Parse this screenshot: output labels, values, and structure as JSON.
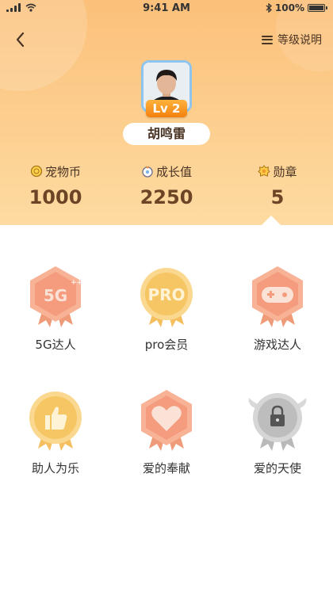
{
  "status_bar": {
    "time": "9:41 AM",
    "battery": "100%"
  },
  "header": {
    "level_desc_label": "等级说明"
  },
  "profile": {
    "level": "Lv 2",
    "name": "胡鸣雷"
  },
  "stats": [
    {
      "label": "宠物币",
      "value": "1000",
      "icon": "coin-icon"
    },
    {
      "label": "成长值",
      "value": "2250",
      "icon": "growth-icon"
    },
    {
      "label": "勋章",
      "value": "5",
      "icon": "medal-icon"
    }
  ],
  "badges": [
    {
      "name": "5G达人",
      "art_text": "5G",
      "style": "salmon",
      "locked": false
    },
    {
      "name": "pro会员",
      "art_text": "PRO",
      "style": "gold",
      "locked": false
    },
    {
      "name": "游戏达人",
      "art_text": "",
      "style": "salmon",
      "locked": false
    },
    {
      "name": "助人为乐",
      "art_text": "",
      "style": "gold",
      "locked": false
    },
    {
      "name": "爱的奉献",
      "art_text": "",
      "style": "salmon",
      "locked": false
    },
    {
      "name": "爱的天使",
      "art_text": "",
      "style": "gray",
      "locked": true
    }
  ],
  "colors": {
    "header_start": "#fbc07a",
    "header_end": "#fddba2",
    "salmon": "#f6a07f",
    "gold": "#f7c86a",
    "gray": "#bdbdbd",
    "accent_text": "#6b4526"
  }
}
